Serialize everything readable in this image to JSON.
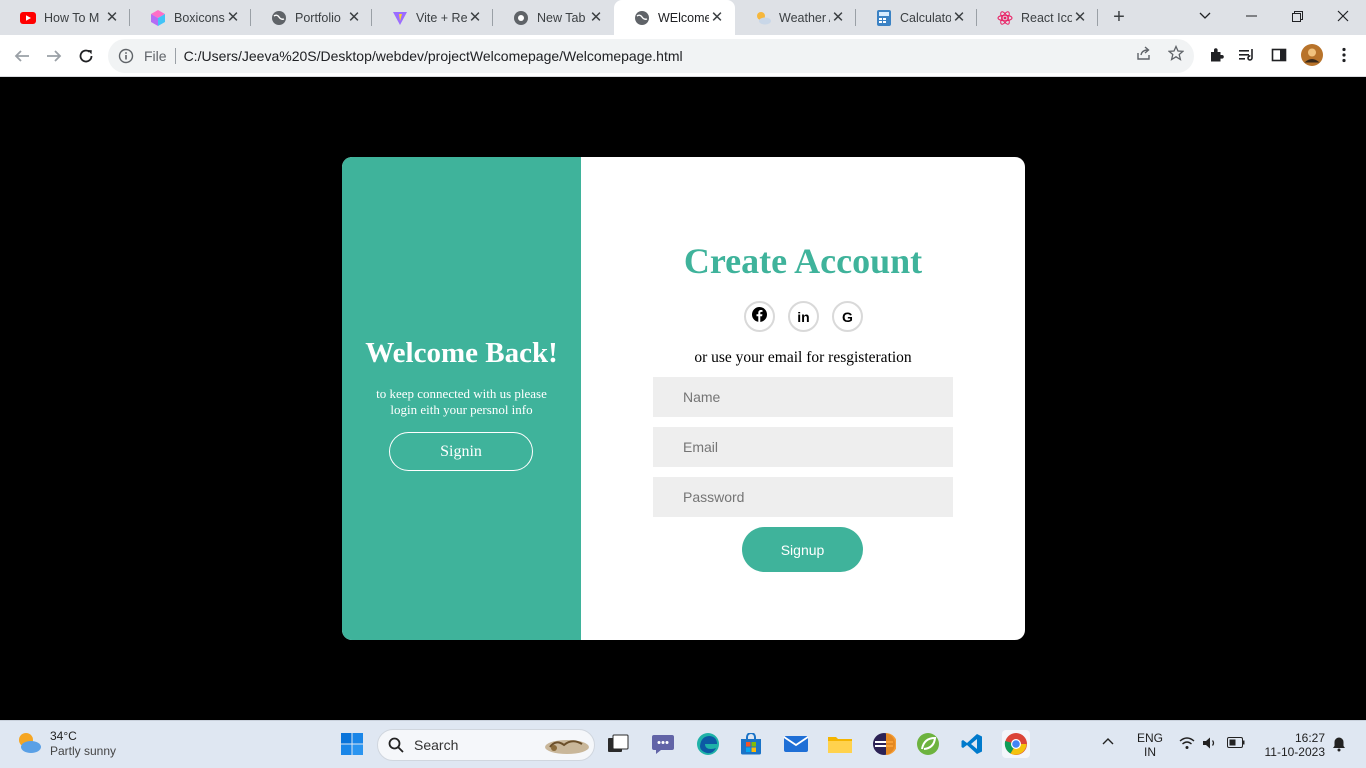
{
  "browser": {
    "tabs": [
      {
        "title": "How To M",
        "icon": "youtube-icon",
        "active": false
      },
      {
        "title": "Boxicons",
        "icon": "boxicons-icon",
        "active": false
      },
      {
        "title": "Portfolio",
        "icon": "globe-icon",
        "active": false
      },
      {
        "title": "Vite + Rea",
        "icon": "vite-icon",
        "active": false
      },
      {
        "title": "New Tab",
        "icon": "chrome-icon",
        "active": false
      },
      {
        "title": "WElcome",
        "icon": "globe-icon",
        "active": true
      },
      {
        "title": "Weather A",
        "icon": "weather-icon",
        "active": false
      },
      {
        "title": "Calculator",
        "icon": "calculator-icon",
        "active": false
      },
      {
        "title": "React Icor",
        "icon": "react-icon",
        "active": false
      }
    ],
    "address": {
      "scheme_label": "File",
      "url": "C:/Users/Jeeva%20S/Desktop/webdev/projectWelcomepage/Welcomepage.html"
    }
  },
  "page": {
    "left_panel": {
      "heading": "Welcome Back!",
      "text": "to keep connected with us please login eith your persnol info",
      "button_label": "Signin",
      "color": "#3fb39b"
    },
    "right_panel": {
      "heading": "Create Account",
      "social": [
        {
          "glyph": "f",
          "name": "facebook-icon"
        },
        {
          "glyph": "in",
          "name": "linkedin-icon"
        },
        {
          "glyph": "G",
          "name": "google-icon"
        }
      ],
      "subtext": "or use your email for resgisteration",
      "fields": {
        "name_placeholder": "Name",
        "email_placeholder": "Email",
        "password_placeholder": "Password"
      },
      "button_label": "Signup"
    }
  },
  "taskbar": {
    "weather": {
      "temp": "34°C",
      "condition": "Partly sunny"
    },
    "search_label": "Search",
    "tray": {
      "lang_line1": "ENG",
      "lang_line2": "IN",
      "time": "16:27",
      "date": "11-10-2023"
    }
  }
}
